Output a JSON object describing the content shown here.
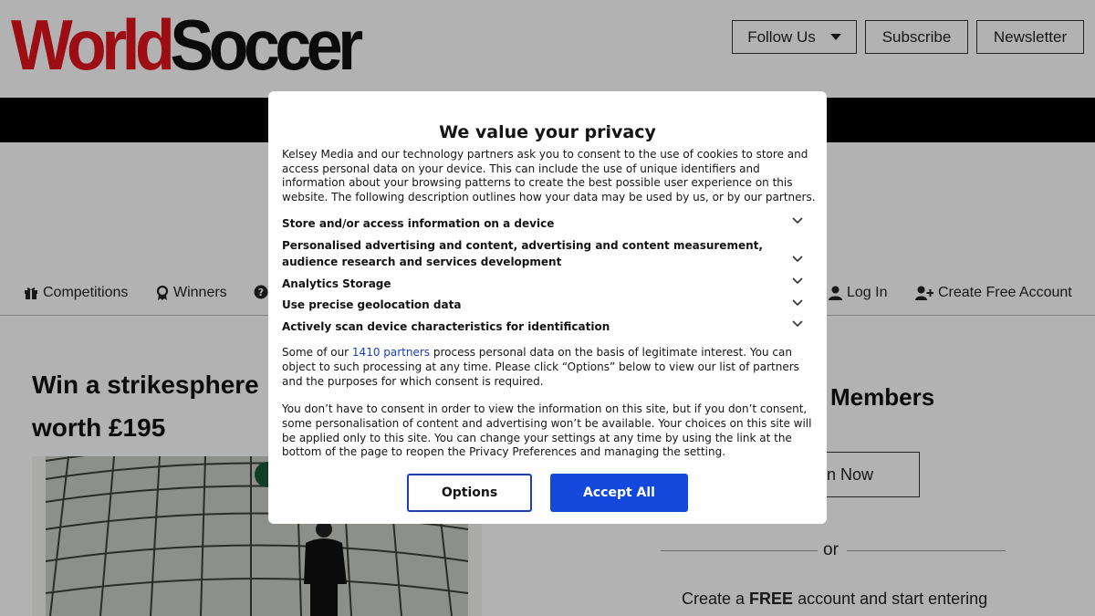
{
  "header": {
    "logo_part1": "World",
    "logo_part2": "Soccer",
    "follow_label": "Follow Us",
    "subscribe_label": "Subscribe",
    "newsletter_label": "Newsletter"
  },
  "nav": {
    "competitions": "Competitions",
    "winners": "Winners",
    "login": "Log In",
    "create_account": "Create Free Account"
  },
  "article": {
    "title_line1": "Win a strikesphere",
    "title_line2": "worth £195"
  },
  "sidebar": {
    "heading": "Members",
    "join_label": "n Now",
    "or_text": "or",
    "create_prefix": "Create a ",
    "create_bold": "FREE",
    "create_suffix": " account and start entering"
  },
  "consent": {
    "title": "We value your privacy",
    "intro": "Kelsey Media and our technology partners ask you to consent to the use of cookies to store and access personal data on your device. This can include the use of unique identifiers and information about your browsing patterns to create the best possible user experience on this website. The following description outlines how your data may be used by us, or by our partners.",
    "purposes": [
      "Store and/or access information on a device",
      "Personalised advertising and content, advertising and content measurement, audience research and services development",
      "Analytics Storage",
      "Use precise geolocation data",
      "Actively scan device characteristics for identification"
    ],
    "legit_prefix": "Some of our ",
    "partners_link": "1410 partners",
    "legit_suffix": " process personal data on the basis of legitimate interest. You can object to such processing at any time. Please click “Options” below to view our list of partners and the purposes for which consent is required.",
    "no_consent": "You don’t have to consent in order to view the information on this site, but if you don’t consent, some personalisation of content and advertising won’t be available. Your choices on this site will be applied only to this site. You can change your settings at any time by using the link at the bottom of the page to reopen the Privacy Preferences and managing the setting.",
    "options_label": "Options",
    "accept_label": "Accept All"
  },
  "colors": {
    "brand_red": "#e0141e",
    "accept_blue": "#1447dc",
    "link_blue": "#1a3fb8"
  }
}
